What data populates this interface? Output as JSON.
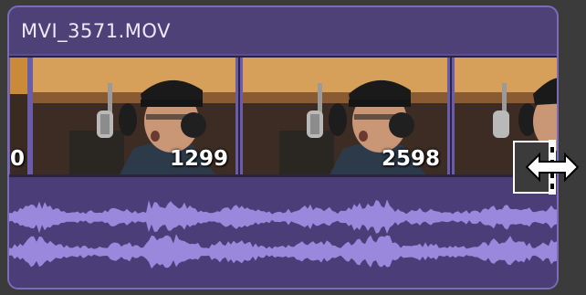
{
  "clip": {
    "title": "MVI_3571.MOV"
  },
  "filmstrip": {
    "frames": [
      {
        "label": "0"
      },
      {
        "label": "1299"
      },
      {
        "label": "2598"
      },
      {
        "label": ""
      }
    ]
  },
  "colors": {
    "clip_background": "#4e4178",
    "clip_border": "#7b6bb8",
    "waveform": "#9a88dc",
    "audio_background": "#4a3d78"
  },
  "icons": {
    "cursor": "trim-resize-cursor-icon"
  }
}
